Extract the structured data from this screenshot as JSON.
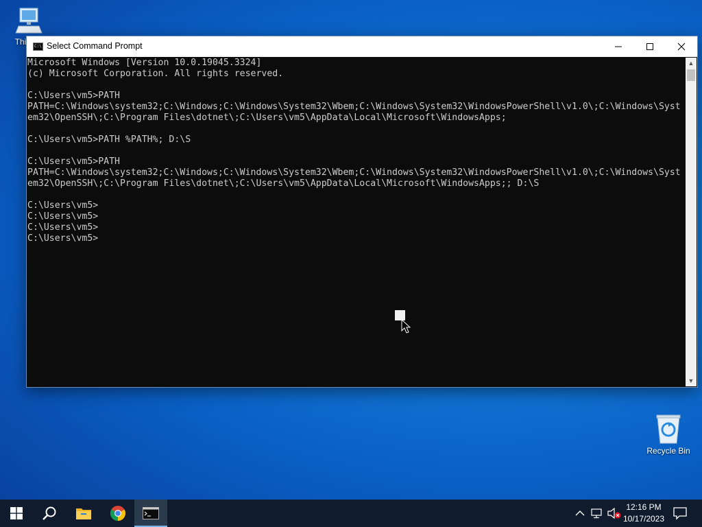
{
  "desktop": {
    "icons": [
      {
        "label": "This PC",
        "icon": "computer-icon"
      },
      {
        "label": "Recycle Bin",
        "icon": "recycle-bin-icon"
      }
    ]
  },
  "window": {
    "title": "Select Command Prompt",
    "controls": {
      "minimize": "minimize-icon",
      "maximize": "maximize-icon",
      "close": "close-icon"
    },
    "console_lines": [
      "Microsoft Windows [Version 10.0.19045.3324]",
      "(c) Microsoft Corporation. All rights reserved.",
      "",
      "C:\\Users\\vm5>PATH",
      "PATH=C:\\Windows\\system32;C:\\Windows;C:\\Windows\\System32\\Wbem;C:\\Windows\\System32\\WindowsPowerShell\\v1.0\\;C:\\Windows\\Syst",
      "em32\\OpenSSH\\;C:\\Program Files\\dotnet\\;C:\\Users\\vm5\\AppData\\Local\\Microsoft\\WindowsApps;",
      "",
      "C:\\Users\\vm5>PATH %PATH%; D:\\S",
      "",
      "C:\\Users\\vm5>PATH",
      "PATH=C:\\Windows\\system32;C:\\Windows;C:\\Windows\\System32\\Wbem;C:\\Windows\\System32\\WindowsPowerShell\\v1.0\\;C:\\Windows\\Syst",
      "em32\\OpenSSH\\;C:\\Program Files\\dotnet\\;C:\\Users\\vm5\\AppData\\Local\\Microsoft\\WindowsApps;; D:\\S",
      "",
      "C:\\Users\\vm5>",
      "C:\\Users\\vm5>",
      "C:\\Users\\vm5>",
      "C:\\Users\\vm5>"
    ]
  },
  "taskbar": {
    "apps": [
      "windows-start-icon",
      "search-icon",
      "file-explorer-icon",
      "chrome-icon",
      "command-prompt-icon"
    ],
    "tray": [
      "chevron-up-icon",
      "network-icon",
      "volume-muted-icon"
    ],
    "clock": {
      "time": "12:16 PM",
      "date": "10/17/2023"
    }
  },
  "colors": {
    "console_bg": "#0c0c0c",
    "console_fg": "#cccccc",
    "taskbar_bg": "#101c2e",
    "desktop_blue": "#1177d6"
  }
}
